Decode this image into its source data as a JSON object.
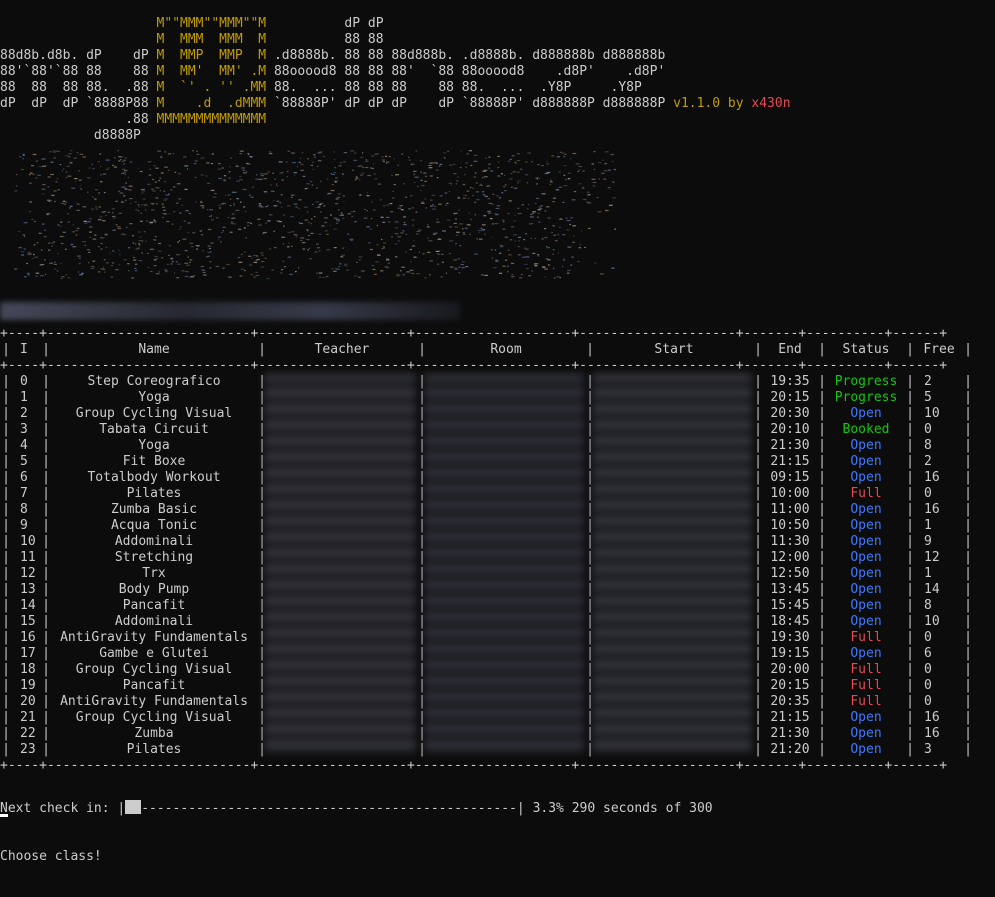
{
  "banner": {
    "lines": [
      "                    M\"\"MMM\"\"MMM\"\"M          dP dP",
      "                    M  MMM  MMM  M          88 88",
      "88d8b.d8b. dP    dP M  MMP  MMP  M .d8888b. 88 88 88d888b. .d8888b. d888888b d888888b",
      "88'`88'`88 88    88 M  MM'  MM' .M 88ooood8 88 88 88'  `88 88ooood8    .d8P'    .d8P'",
      "88  88  88 88.  .88 M  `' . '' .MM 88.  ... 88 88 88    88 88.  ...  .Y8P     .Y8P",
      "dP  dP  dP `8888P88 M    .d  .dMMM `88888P' dP dP dP    dP `88888P' d888888P d888888P",
      "                .88 MMMMMMMMMMMMMM",
      "            d8888P"
    ],
    "version": "v1.1.0",
    "by": "by",
    "author": "x430n"
  },
  "table": {
    "headers": [
      "I",
      "Name",
      "Teacher",
      "Room",
      "Start",
      "End",
      "Status",
      "Free"
    ],
    "rows": [
      {
        "i": "0",
        "name": "Step Coreografico",
        "end": "19:35",
        "status": "Progress",
        "free": "2"
      },
      {
        "i": "1",
        "name": "Yoga",
        "end": "20:15",
        "status": "Progress",
        "free": "5"
      },
      {
        "i": "2",
        "name": "Group Cycling Visual",
        "end": "20:30",
        "status": "Open",
        "free": "10"
      },
      {
        "i": "3",
        "name": "Tabata Circuit",
        "end": "20:10",
        "status": "Booked",
        "free": "0"
      },
      {
        "i": "4",
        "name": "Yoga",
        "end": "21:30",
        "status": "Open",
        "free": "8"
      },
      {
        "i": "5",
        "name": "Fit Boxe",
        "end": "21:15",
        "status": "Open",
        "free": "2"
      },
      {
        "i": "6",
        "name": "Totalbody Workout",
        "end": "09:15",
        "status": "Open",
        "free": "16"
      },
      {
        "i": "7",
        "name": "Pilates",
        "end": "10:00",
        "status": "Full",
        "free": "0"
      },
      {
        "i": "8",
        "name": "Zumba Basic",
        "end": "11:00",
        "status": "Open",
        "free": "16"
      },
      {
        "i": "9",
        "name": "Acqua Tonic",
        "end": "10:50",
        "status": "Open",
        "free": "1"
      },
      {
        "i": "10",
        "name": "Addominali",
        "end": "11:30",
        "status": "Open",
        "free": "9"
      },
      {
        "i": "11",
        "name": "Stretching",
        "end": "12:00",
        "status": "Open",
        "free": "12"
      },
      {
        "i": "12",
        "name": "Trx",
        "end": "12:50",
        "status": "Open",
        "free": "1"
      },
      {
        "i": "13",
        "name": "Body Pump",
        "end": "13:45",
        "status": "Open",
        "free": "14"
      },
      {
        "i": "14",
        "name": "Pancafit",
        "end": "15:45",
        "status": "Open",
        "free": "8"
      },
      {
        "i": "15",
        "name": "Addominali",
        "end": "18:45",
        "status": "Open",
        "free": "10"
      },
      {
        "i": "16",
        "name": "AntiGravity Fundamentals",
        "end": "19:30",
        "status": "Full",
        "free": "0"
      },
      {
        "i": "17",
        "name": "Gambe e Glutei",
        "end": "19:15",
        "status": "Open",
        "free": "6"
      },
      {
        "i": "18",
        "name": "Group Cycling Visual",
        "end": "20:00",
        "status": "Full",
        "free": "0"
      },
      {
        "i": "19",
        "name": "Pancafit",
        "end": "20:15",
        "status": "Full",
        "free": "0"
      },
      {
        "i": "20",
        "name": "AntiGravity Fundamentals",
        "end": "20:35",
        "status": "Full",
        "free": "0"
      },
      {
        "i": "21",
        "name": "Group Cycling Visual",
        "end": "21:15",
        "status": "Open",
        "free": "16"
      },
      {
        "i": "22",
        "name": "Zumba",
        "end": "21:30",
        "status": "Open",
        "free": "16"
      },
      {
        "i": "23",
        "name": "Pilates",
        "end": "21:20",
        "status": "Open",
        "free": "3"
      }
    ]
  },
  "status_colors": {
    "Progress": "#16c60c",
    "Booked": "#16c60c",
    "Open": "#3b78ff",
    "Full": "#e74856"
  },
  "footer": {
    "next_check_label": "Next check in:",
    "progress_fraction": 0.033,
    "percent_text": "3.3%",
    "seconds_text": "290 seconds of 300",
    "prompt": "Choose class!"
  }
}
